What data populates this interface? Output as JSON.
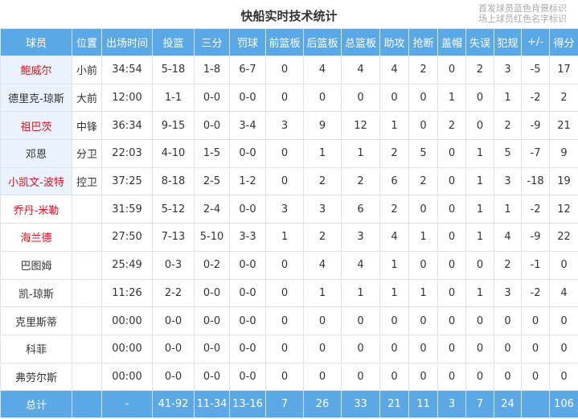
{
  "title": "快船实时技术统计",
  "legend": [
    "首发球员蓝色背景标识",
    "场上球员红色名字标识"
  ],
  "columns": [
    "球员",
    "位置",
    "出场时间",
    "投篮",
    "三分",
    "罚球",
    "前篮板",
    "后篮板",
    "总篮板",
    "助攻",
    "抢断",
    "盖帽",
    "失误",
    "犯规",
    "+/-",
    "得分"
  ],
  "colors": {
    "header_bg": "#5ba8e6",
    "starter_bg": "#eaf2fc",
    "oncourt_text": "#e1111b"
  },
  "players": [
    {
      "name": "鲍威尔",
      "starter": true,
      "oncourt": true,
      "cells": [
        "小前",
        "34:54",
        "5-18",
        "1-8",
        "6-7",
        "0",
        "4",
        "4",
        "4",
        "2",
        "0",
        "2",
        "3",
        "-5",
        "17"
      ]
    },
    {
      "name": "德里克-琼斯",
      "starter": true,
      "oncourt": false,
      "cells": [
        "大前",
        "12:00",
        "1-1",
        "0-0",
        "0-0",
        "0",
        "0",
        "0",
        "0",
        "0",
        "1",
        "0",
        "1",
        "-2",
        "2"
      ]
    },
    {
      "name": "祖巴茨",
      "starter": true,
      "oncourt": true,
      "cells": [
        "中锋",
        "36:34",
        "9-15",
        "0-0",
        "3-4",
        "3",
        "9",
        "12",
        "1",
        "0",
        "2",
        "0",
        "2",
        "-9",
        "21"
      ]
    },
    {
      "name": "邓恩",
      "starter": true,
      "oncourt": false,
      "cells": [
        "分卫",
        "22:03",
        "4-10",
        "1-5",
        "0-0",
        "0",
        "1",
        "1",
        "2",
        "5",
        "0",
        "1",
        "5",
        "-7",
        "9"
      ]
    },
    {
      "name": "小凯文-波特",
      "starter": true,
      "oncourt": true,
      "cells": [
        "控卫",
        "37:25",
        "8-18",
        "2-5",
        "1-2",
        "0",
        "2",
        "2",
        "6",
        "2",
        "0",
        "1",
        "3",
        "-18",
        "19"
      ]
    },
    {
      "name": "乔丹-米勒",
      "starter": false,
      "oncourt": true,
      "cells": [
        "",
        "31:59",
        "5-12",
        "2-4",
        "0-0",
        "3",
        "3",
        "6",
        "2",
        "0",
        "0",
        "1",
        "1",
        "-2",
        "12"
      ]
    },
    {
      "name": "海兰德",
      "starter": false,
      "oncourt": true,
      "cells": [
        "",
        "27:50",
        "7-13",
        "5-10",
        "3-3",
        "1",
        "2",
        "3",
        "4",
        "1",
        "0",
        "1",
        "4",
        "-9",
        "22"
      ]
    },
    {
      "name": "巴图姆",
      "starter": false,
      "oncourt": false,
      "cells": [
        "",
        "25:49",
        "0-3",
        "0-2",
        "0-0",
        "0",
        "4",
        "4",
        "1",
        "0",
        "0",
        "0",
        "2",
        "-1",
        "0"
      ]
    },
    {
      "name": "凯-琼斯",
      "starter": false,
      "oncourt": false,
      "cells": [
        "",
        "11:26",
        "2-2",
        "0-0",
        "0-0",
        "0",
        "1",
        "1",
        "1",
        "1",
        "0",
        "1",
        "3",
        "-2",
        "4"
      ]
    },
    {
      "name": "克里斯蒂",
      "starter": false,
      "oncourt": false,
      "cells": [
        "",
        "00:00",
        "0-0",
        "0-0",
        "0-0",
        "0",
        "0",
        "0",
        "0",
        "0",
        "0",
        "0",
        "0",
        "0",
        "0"
      ]
    },
    {
      "name": "科菲",
      "starter": false,
      "oncourt": false,
      "cells": [
        "",
        "00:00",
        "0-0",
        "0-0",
        "0-0",
        "0",
        "0",
        "0",
        "0",
        "0",
        "0",
        "0",
        "0",
        "0",
        "0"
      ]
    },
    {
      "name": "弗劳尔斯",
      "starter": false,
      "oncourt": false,
      "cells": [
        "",
        "00:00",
        "0-0",
        "0-0",
        "0-0",
        "0",
        "0",
        "0",
        "0",
        "0",
        "0",
        "0",
        "0",
        "0",
        "0"
      ]
    }
  ],
  "totals": {
    "label": "总计",
    "cells": [
      "",
      "-",
      "41-92",
      "11-34",
      "13-16",
      "7",
      "26",
      "33",
      "21",
      "11",
      "3",
      "7",
      "24",
      "",
      "106"
    ]
  }
}
